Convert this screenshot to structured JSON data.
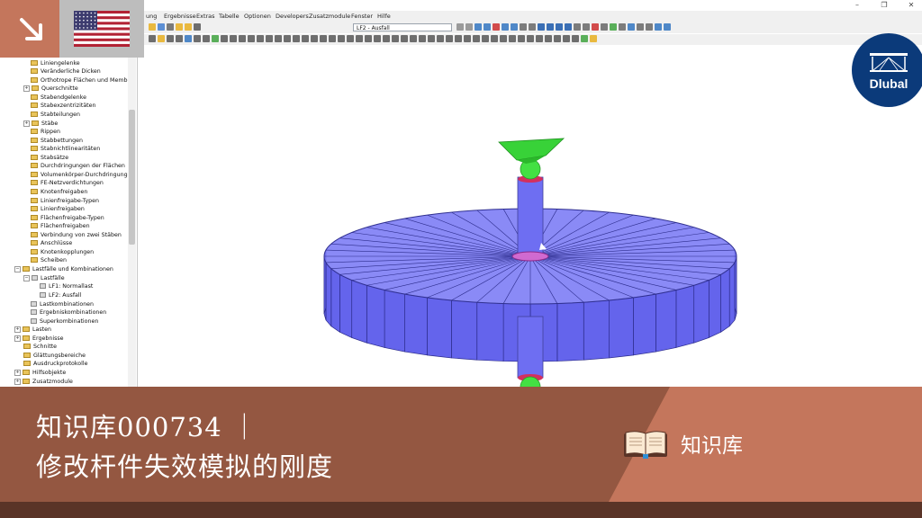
{
  "window": {
    "minimize_label": "–",
    "maximize_label": "❐",
    "close_label": "✕"
  },
  "menu": {
    "items": [
      "ung",
      "Ergebnisse",
      "Extras",
      "Tabelle",
      "Optionen",
      "Developers",
      "Zusatzmodule",
      "Fenster",
      "Hilfe"
    ]
  },
  "toolbar": {
    "loadcase_combo": "LF2 - Ausfall"
  },
  "navigator": {
    "items": [
      "Liniengelenke",
      "Veränderliche Dicken",
      "Orthotrope Flächen und Membrar",
      "Querschnitte",
      "Stabendgelenke",
      "Stabexzentrizitäten",
      "Stabteilungen",
      "Stäbe",
      "Rippen",
      "Stabbettungen",
      "Stabnichtlinearitäten",
      "Stabsätze",
      "Durchdringungen der Flächen",
      "Volumenkörper-Durchdringunger",
      "FE-Netzverdichtungen",
      "Knotenfreigaben",
      "Linienfreigabe-Typen",
      "Linienfreigaben",
      "Flächenfreigabe-Typen",
      "Flächenfreigaben",
      "Verbindung von zwei Stäben",
      "Anschlüsse",
      "Knotenkopplungen",
      "Scheiben",
      "Lastfälle und Kombinationen",
      "Lastfälle",
      "LF1: Normallast",
      "LF2: Ausfall",
      "Lastkombinationen",
      "Ergebniskombinationen",
      "Superkombinationen",
      "Lasten",
      "Ergebnisse",
      "Schnitte",
      "Glättungsbereiche",
      "Ausdruckprotokolle",
      "Hilfsobjekte",
      "Zusatzmodule"
    ]
  },
  "logo": {
    "brand": "Dlubal"
  },
  "banner": {
    "title": "知识库000734 ｜",
    "subtitle": "修改杆件失效模拟的刚度",
    "kb_label": "知识库"
  },
  "colors": {
    "banner_brown": "#945741",
    "banner_accent": "#c4765c",
    "dlubal_blue": "#0b3a7a",
    "model_blue": "#6f6ff0",
    "support_green": "#3ddc3d"
  }
}
